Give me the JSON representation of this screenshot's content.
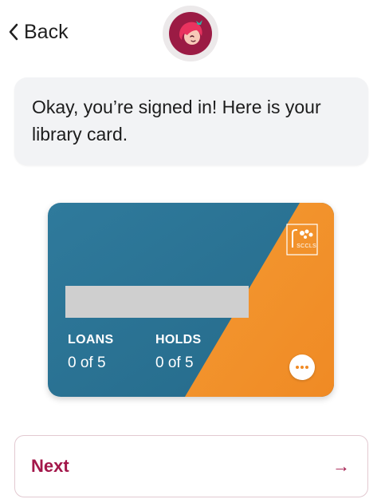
{
  "header": {
    "back_label": "Back",
    "logo_icon": "reading-girl-logo-icon"
  },
  "message": {
    "text": "Okay, you’re signed in! Here is your library card."
  },
  "card": {
    "library_abbrev": "SCCLS",
    "loans_label": "LOANS",
    "loans_value": "0 of 5",
    "holds_label": "HOLDS",
    "holds_value": "0 of 5",
    "colors": {
      "blue": "#2b7395",
      "orange": "#f3922c"
    },
    "more_icon": "more-dots-icon"
  },
  "footer": {
    "next_label": "Next",
    "next_arrow": "→"
  },
  "colors": {
    "accent": "#a3174a",
    "logo_bg": "#9b1b44"
  }
}
